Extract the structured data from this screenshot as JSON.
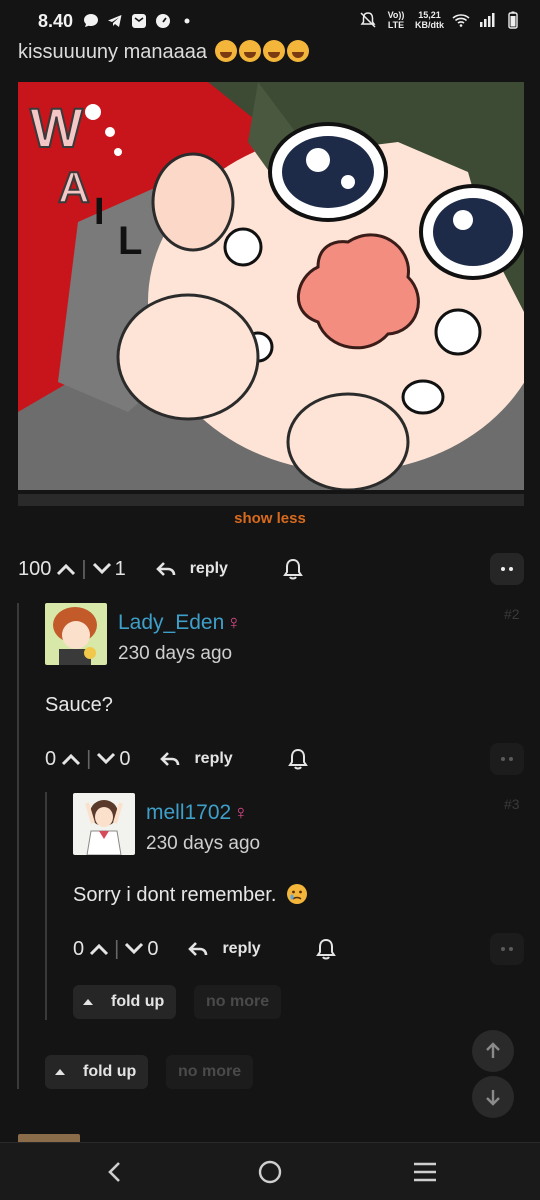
{
  "status_bar": {
    "time": "8.40",
    "network": "Vo)) LTE",
    "speed_value": "15,21",
    "speed_unit": "KB/dtk"
  },
  "post": {
    "text": "kissuuuuny manaaaa",
    "emoji": "loudly-crying-face",
    "emoji_count": 4,
    "image_description": "anime boy wailing",
    "image_text": [
      "W",
      "A",
      "I",
      "L"
    ],
    "show_less_label": "show less",
    "upvotes": "100",
    "downvotes": "1",
    "reply_label": "reply"
  },
  "comments": [
    {
      "username": "Lady_Eden",
      "gender_symbol": "♀",
      "time": "230 days ago",
      "number": "#2",
      "text": "Sauce?",
      "upvotes": "0",
      "downvotes": "0",
      "reply_label": "reply"
    },
    {
      "username": "mell1702",
      "gender_symbol": "♀",
      "time": "230 days ago",
      "number": "#3",
      "text": "Sorry i dont remember.",
      "emoji": "crying-face",
      "upvotes": "0",
      "downvotes": "0",
      "reply_label": "reply"
    }
  ],
  "controls": {
    "fold_up_label": "fold up",
    "no_more_label": "no more"
  },
  "colors": {
    "background": "#141414",
    "accent_orange": "#d86a1e",
    "username_blue": "#3e9fc9",
    "female_pink": "#e04a8c"
  }
}
